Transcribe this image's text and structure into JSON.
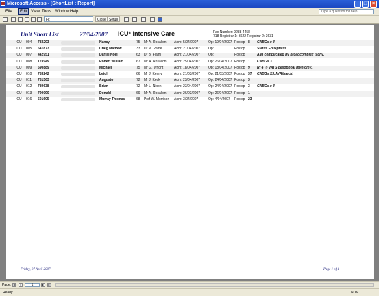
{
  "window": {
    "title": "Microsoft Access - [ShortList : Report]"
  },
  "menu": {
    "items": [
      "File",
      "Edit",
      "View",
      "Tools",
      "Window",
      "Help"
    ],
    "help_placeholder": "Type a question for help"
  },
  "toolbar": {
    "zoom": "Fit",
    "close_label": "Close",
    "setup_label": "Setup"
  },
  "report": {
    "title": "Unit Short List",
    "date": "27/04/2007",
    "unit": "ICU* Intensive Care",
    "fax": "Fax Number: 9288 4458",
    "registrars": "718 Registrar 1: 3622  Registrar 2: 3631",
    "rows": [
      {
        "unit": "ICU",
        "bed": "004",
        "mrn": "783293",
        "name": "Nancy",
        "age": "75",
        "consultant": "Mr A. Rosalion",
        "adm": "Adm: 5/04/2007",
        "op": "Op: 19/04/2007",
        "postop": "Postop",
        "day": "8",
        "note": "CABGs x 4"
      },
      {
        "unit": "ICU",
        "bed": "005",
        "mrn": "641873",
        "name": "Craig Mathew",
        "age": "33",
        "consultant": "Dr M. Paine",
        "adm": "Adm: 21/04/2007",
        "op": "Op:",
        "postop": "Postop",
        "day": "",
        "note": "Status Epilepticus"
      },
      {
        "unit": "ICU",
        "bed": "007",
        "mrn": "442951",
        "name": "Darral Noel",
        "age": "63",
        "consultant": "Dr B. Flaim",
        "adm": "Adm: 21/04/2007",
        "op": "Op:",
        "postop": "Postop",
        "day": "",
        "note": "AMI complicated by broadcomplex     tachy."
      },
      {
        "unit": "ICU",
        "bed": "008",
        "mrn": "123949",
        "name": "Robert William",
        "age": "67",
        "consultant": "Mr A. Rosalion",
        "adm": "Adm: 25/04/2007",
        "op": "Op: 26/04/2007",
        "postop": "Postop",
        "day": "1",
        "note": "CABGs 3"
      },
      {
        "unit": "ICU",
        "bed": "009",
        "mrn": "690889",
        "name": "Michael",
        "age": "75",
        "consultant": "Mr G. Wright",
        "adm": "Adm: 18/04/2007",
        "op": "Op: 18/04/2007",
        "postop": "Postop",
        "day": "9",
        "note": "Rt 4 -> VATS oesophoal myotomy."
      },
      {
        "unit": "ICU",
        "bed": "010",
        "mrn": "783242",
        "name": "Leigh",
        "age": "66",
        "consultant": "Mr J. Kenny",
        "adm": "Adm: 21/03/2007",
        "op": "Op: 21/03/2007",
        "postop": "Postop",
        "day": "37",
        "note": "CABGs X3,AVR(mech)"
      },
      {
        "unit": "ICU",
        "bed": "011",
        "mrn": "781563",
        "name": "Augusto",
        "age": "72",
        "consultant": "Mr J. Keck",
        "adm": "Adm: 23/04/2007",
        "op": "Op: 24/04/2007",
        "postop": "Postop",
        "day": "3",
        "note": ""
      },
      {
        "unit": "ICU",
        "bed": "012",
        "mrn": "789638",
        "name": "Brian",
        "age": "72",
        "consultant": "Mr L. Nixon",
        "adm": "Adm: 23/04/2007",
        "op": "Op: 24/04/2007",
        "postop": "Postop",
        "day": "3",
        "note": "CABGs x 4"
      },
      {
        "unit": "ICU",
        "bed": "013",
        "mrn": "790090",
        "name": "Donald",
        "age": "69",
        "consultant": "Mr A. Rosalion",
        "adm": "Adm: 26/03/2007",
        "op": "Op: 26/04/2007",
        "postop": "Postop",
        "day": "1",
        "note": ""
      },
      {
        "unit": "ICU",
        "bed": "016",
        "mrn": "501605",
        "name": "Murray Thomas",
        "age": "68",
        "consultant": "Prof W. Morrison",
        "adm": "Adm: 3/04/2007",
        "op": "Op: 4/04/2007",
        "postop": "Postop",
        "day": "23",
        "note": ""
      }
    ],
    "footer_date": "Friday, 27 April 2007",
    "footer_page": "Page 1 of 1"
  },
  "nav": {
    "label": "Page:",
    "page": "1"
  },
  "status": {
    "left": "Ready",
    "right": "NUM"
  }
}
